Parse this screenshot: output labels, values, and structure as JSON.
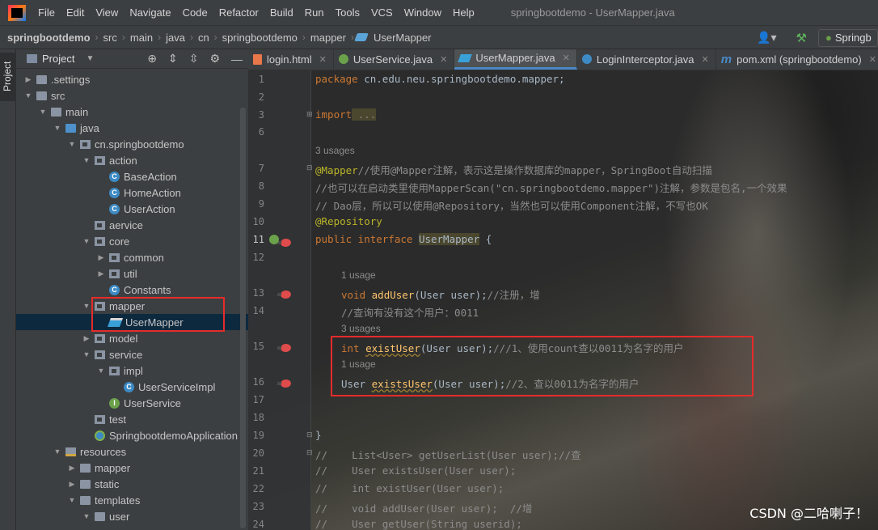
{
  "menu": {
    "items": [
      "File",
      "Edit",
      "View",
      "Navigate",
      "Code",
      "Refactor",
      "Build",
      "Run",
      "Tools",
      "VCS",
      "Window",
      "Help"
    ],
    "title": "springbootdemo - UserMapper.java"
  },
  "nav": {
    "crumbs": [
      "springbootdemo",
      "src",
      "main",
      "java",
      "cn",
      "springbootdemo",
      "mapper",
      "UserMapper"
    ],
    "run_config": "Springb"
  },
  "sidebar": {
    "tab_label": "Project"
  },
  "project": {
    "header": "Project",
    "tree": [
      {
        "label": ".settings",
        "depth": 1,
        "arrow": ">",
        "icon": "folder"
      },
      {
        "label": "src",
        "depth": 1,
        "arrow": "v",
        "icon": "folder"
      },
      {
        "label": "main",
        "depth": 2,
        "arrow": "v",
        "icon": "folder"
      },
      {
        "label": "java",
        "depth": 3,
        "arrow": "v",
        "icon": "folder-blue"
      },
      {
        "label": "cn.springbootdemo",
        "depth": 4,
        "arrow": "v",
        "icon": "pkg"
      },
      {
        "label": "action",
        "depth": 5,
        "arrow": "v",
        "icon": "pkg"
      },
      {
        "label": "BaseAction",
        "depth": 6,
        "arrow": "",
        "icon": "cls"
      },
      {
        "label": "HomeAction",
        "depth": 6,
        "arrow": "",
        "icon": "cls"
      },
      {
        "label": "UserAction",
        "depth": 6,
        "arrow": "",
        "icon": "cls"
      },
      {
        "label": "aervice",
        "depth": 5,
        "arrow": "",
        "icon": "pkg"
      },
      {
        "label": "core",
        "depth": 5,
        "arrow": "v",
        "icon": "pkg"
      },
      {
        "label": "common",
        "depth": 6,
        "arrow": ">",
        "icon": "pkg"
      },
      {
        "label": "util",
        "depth": 6,
        "arrow": ">",
        "icon": "pkg"
      },
      {
        "label": "Constants",
        "depth": 6,
        "arrow": "",
        "icon": "cls"
      },
      {
        "label": "mapper",
        "depth": 5,
        "arrow": "v",
        "icon": "pkg"
      },
      {
        "label": "UserMapper",
        "depth": 6,
        "arrow": "",
        "icon": "mybatis",
        "selected": true
      },
      {
        "label": "model",
        "depth": 5,
        "arrow": ">",
        "icon": "pkg"
      },
      {
        "label": "service",
        "depth": 5,
        "arrow": "v",
        "icon": "pkg"
      },
      {
        "label": "impl",
        "depth": 6,
        "arrow": "v",
        "icon": "pkg"
      },
      {
        "label": "UserServiceImpl",
        "depth": 7,
        "arrow": "",
        "icon": "cls"
      },
      {
        "label": "UserService",
        "depth": 6,
        "arrow": "",
        "icon": "intf"
      },
      {
        "label": "test",
        "depth": 5,
        "arrow": "",
        "icon": "pkg"
      },
      {
        "label": "SpringbootdemoApplication",
        "depth": 5,
        "arrow": "",
        "icon": "app"
      },
      {
        "label": "resources",
        "depth": 3,
        "arrow": "v",
        "icon": "res"
      },
      {
        "label": "mapper",
        "depth": 4,
        "arrow": ">",
        "icon": "folder"
      },
      {
        "label": "static",
        "depth": 4,
        "arrow": ">",
        "icon": "folder"
      },
      {
        "label": "templates",
        "depth": 4,
        "arrow": "v",
        "icon": "folder"
      },
      {
        "label": "user",
        "depth": 5,
        "arrow": "v",
        "icon": "folder"
      }
    ]
  },
  "tabs": [
    {
      "label": "login.html",
      "icon": "html"
    },
    {
      "label": "UserService.java",
      "icon": "intf"
    },
    {
      "label": "UserMapper.java",
      "icon": "mb",
      "active": true
    },
    {
      "label": "LoginInterceptor.java",
      "icon": "cls"
    },
    {
      "label": "pom.xml (springbootdemo)",
      "icon": "m"
    }
  ],
  "editor": {
    "line_numbers": [
      "1",
      "2",
      "3",
      "6",
      "7",
      "8",
      "9",
      "10",
      "11",
      "12",
      "13",
      "14",
      "15",
      "16",
      "17",
      "18",
      "19",
      "20",
      "21",
      "22",
      "23",
      "24"
    ],
    "code": {
      "l1_kw": "package",
      "l1_rest": " cn.edu.neu.springbootdemo.mapper;",
      "l3_kw": "import",
      "l3_rest": " ...",
      "usages_3": "3 usages",
      "l7_an": "@Mapper",
      "l7_cm": "//使用@Mapper注解，表示这是操作数据库的mapper，SpringBoot自动扫描",
      "l8_cm": "//也可以在启动类里使用MapperScan(\"cn.springbootdemo.mapper\")注解，参数是包名,一个效果",
      "l9_cm": "// Dao层，所以可以使用@Repository，当然也可以使用Component注解，不写也OK",
      "l10_an": "@Repository",
      "l11_kw": "public interface",
      "l11_name": "UserMapper",
      "l11_rest": " {",
      "usage_1a": "1 usage",
      "l13_kw": "void",
      "l13_fn": "addUser",
      "l13_rest": "(User user);",
      "l13_cm": "//注册，增",
      "l14_cm": "//查询有没有这个用户：0011",
      "usages_3b": "3 usages",
      "l15_kw": "int",
      "l15_fn": "existUser",
      "l15_rest": "(User user);",
      "l15_cm": "///1、使用count查以0011为名字的用户",
      "usage_1b": "1 usage",
      "l16_ty": "User",
      "l16_fn": "existsUser",
      "l16_rest": "(User user);",
      "l16_cm": "//2、查以0011为名字的用户",
      "l19": "}",
      "l20": "//    List<User> getUserList(User user);//查",
      "l21": "//    User existsUser(User user);",
      "l22": "//    int existUser(User user);",
      "l23": "//    void addUser(User user);  //增",
      "l24": "//    User getUser(String userid);"
    }
  },
  "watermark": "CSDN @二哈喇子！"
}
